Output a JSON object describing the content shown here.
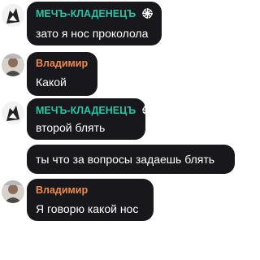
{
  "colors": {
    "bubble_bg": "#18181c",
    "name_1": "#29c4a8",
    "name_2": "#f08a4b",
    "text": "#ffffff"
  },
  "messages": [
    {
      "author": "МЕЧЪ-КЛАДЕНЕЦЪ",
      "text": "зато я нос проколола",
      "badge_icon": "kolovrat-icon"
    },
    {
      "author": "Владимир",
      "text": "Какой"
    },
    {
      "author": "МЕЧЪ-КЛАДЕНЕЦЪ",
      "text": "второй блять",
      "badge_icon": "kolovrat-icon"
    },
    {
      "text": "ты что за вопросы задаешь блять"
    },
    {
      "author": "Владимир",
      "text": "Я говорю какой нос"
    }
  ]
}
